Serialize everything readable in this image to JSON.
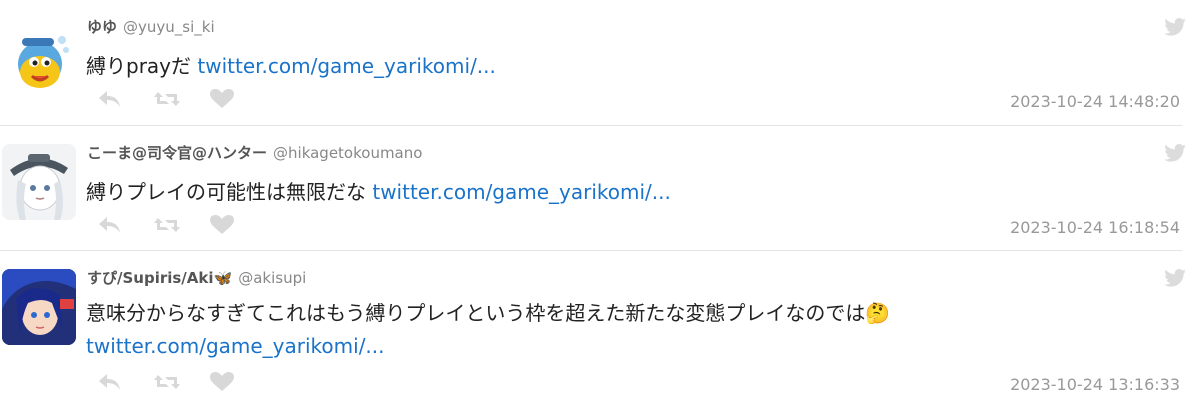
{
  "tweets": [
    {
      "name": "ゆゆ",
      "handle": "@yuyu_si_ki",
      "text": "縛りprayだ ",
      "link": "twitter.com/game_yarikomi/...",
      "link2": "",
      "timestamp": "2023-10-24 14:48:20",
      "avatar": "avatar-yuyu"
    },
    {
      "name": "こーま@司令官@ハンター",
      "handle": "@hikagetokoumano",
      "text": "縛りプレイの可能性は無限だな ",
      "link": "twitter.com/game_yarikomi/...",
      "link2": "",
      "timestamp": "2023-10-24 16:18:54",
      "avatar": "avatar-kooma"
    },
    {
      "name": "すぴ/Supiris/Aki🦋",
      "handle": "@akisupi",
      "text": "意味分からなすぎてこれはもう縛りプレイという枠を超えた新たな変態プレイなのでは🤔",
      "link": "",
      "link2": "twitter.com/game_yarikomi/...",
      "timestamp": "2023-10-24 13:16:33",
      "avatar": "avatar-supi"
    }
  ],
  "icons": {
    "reply": "reply-icon",
    "retweet": "retweet-icon",
    "like": "heart-icon",
    "brand": "twitter-bird-icon"
  },
  "colors": {
    "link": "#1a73c9",
    "timestamp": "#999999",
    "action": "#d8d8d8"
  }
}
